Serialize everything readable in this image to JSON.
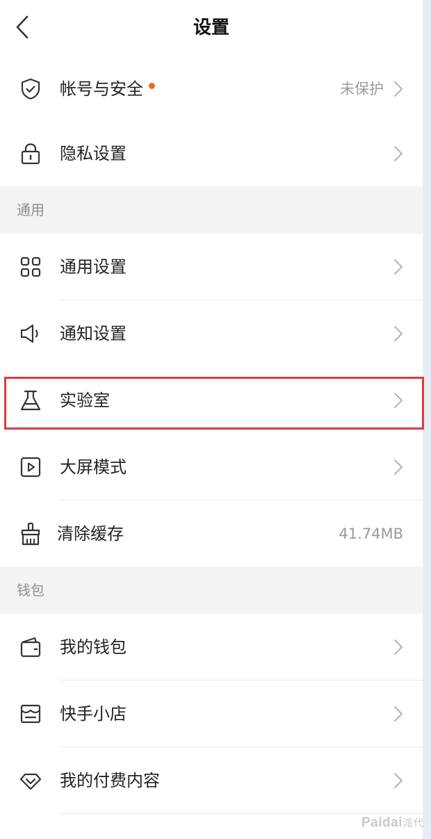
{
  "header": {
    "title": "设置",
    "back_icon": "chevron-left-icon"
  },
  "account": {
    "items": [
      {
        "label": "帐号与安全",
        "value": "未保护",
        "icon": "shield-check-icon",
        "badge_color": "#f06a1e"
      },
      {
        "label": "隐私设置",
        "value": "",
        "icon": "lock-icon"
      }
    ]
  },
  "general": {
    "section_title": "通用",
    "items": [
      {
        "label": "通用设置",
        "value": "",
        "icon": "grid-icon"
      },
      {
        "label": "通知设置",
        "value": "",
        "icon": "speaker-icon"
      },
      {
        "label": "实验室",
        "value": "",
        "icon": "flask-icon"
      },
      {
        "label": "大屏模式",
        "value": "",
        "icon": "play-screen-icon"
      },
      {
        "label": "清除缓存",
        "value": "41.74MB",
        "icon": "broom-icon"
      }
    ]
  },
  "wallet": {
    "section_title": "钱包",
    "items": [
      {
        "label": "我的钱包",
        "value": "",
        "icon": "wallet-icon"
      },
      {
        "label": "快手小店",
        "value": "",
        "icon": "store-icon"
      },
      {
        "label": "我的付费内容",
        "value": "",
        "icon": "diamond-icon"
      }
    ]
  },
  "highlight": {
    "target": "实验室",
    "color": "#e0393e"
  },
  "watermark": {
    "brand": "Paidai",
    "suffix": "派代"
  }
}
